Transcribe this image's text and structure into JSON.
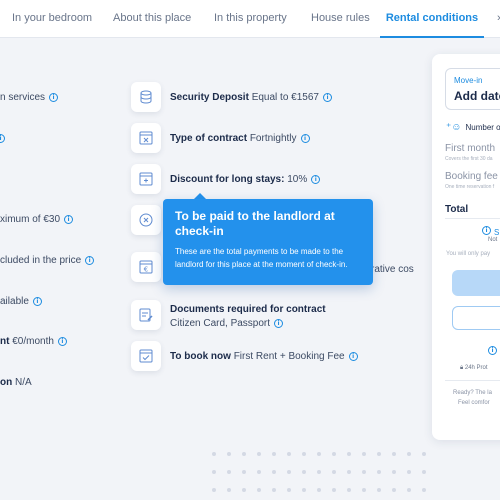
{
  "tabs": [
    {
      "label": "In your bedroom"
    },
    {
      "label": "About this place"
    },
    {
      "label": "In this property"
    },
    {
      "label": "House rules"
    },
    {
      "label": "Rental conditions"
    },
    {
      "label": "›"
    }
  ],
  "left_column": [
    {
      "pre": "",
      "text": "n services"
    },
    {
      "pre": "",
      "text": ""
    },
    {
      "pre": "",
      "text": ""
    },
    {
      "pre": "",
      "text": "ximum of €30"
    },
    {
      "pre": "",
      "text": "cluded in the price"
    },
    {
      "pre": "",
      "text": "ailable"
    },
    {
      "pre": "nt",
      "text": "€0/month"
    },
    {
      "pre": "on",
      "text": "N/A"
    }
  ],
  "conditions": [
    {
      "label": "Security Deposit",
      "value": "Equal to €1567"
    },
    {
      "label": "Type of contract",
      "value": "Fortnightly"
    },
    {
      "label": "Discount for long stays:",
      "value": "10%"
    },
    {
      "label": "Documents required for contract",
      "value": "Citizen Card, Passport"
    },
    {
      "label": "To book now",
      "value": "First Rent + Booking Fee"
    }
  ],
  "hidden_text": "rative cos",
  "tooltip": {
    "title": "To be paid to the landlord at check-in",
    "body": "These are the total payments to be made to the landlord for this place at the moment of check-in."
  },
  "booking_card": {
    "move_in_label": "Move-in",
    "move_in_value": "Add date",
    "occupants": "Number o",
    "first_month": "First month",
    "first_month_sub": "Covers the first 30 da",
    "booking_fee": "Booking fee",
    "booking_fee_sub": "One time reservation f",
    "total": "Total",
    "s_label": "S",
    "not_label": "Not",
    "pay_only": "You will only pay",
    "protection": "24h Prot",
    "ready": "Ready? The la",
    "feel": "Feel comfor"
  },
  "colors": {
    "accent": "#1d8ce0",
    "tooltip_bg": "#2391ec",
    "background": "#f2f4f8"
  },
  "icons": [
    "info-icon",
    "coins-icon",
    "contract-icon",
    "discount-icon",
    "close-circle-icon",
    "calendar-euro-icon",
    "document-pen-icon",
    "calendar-check-icon",
    "add-person-icon",
    "lock-icon"
  ]
}
